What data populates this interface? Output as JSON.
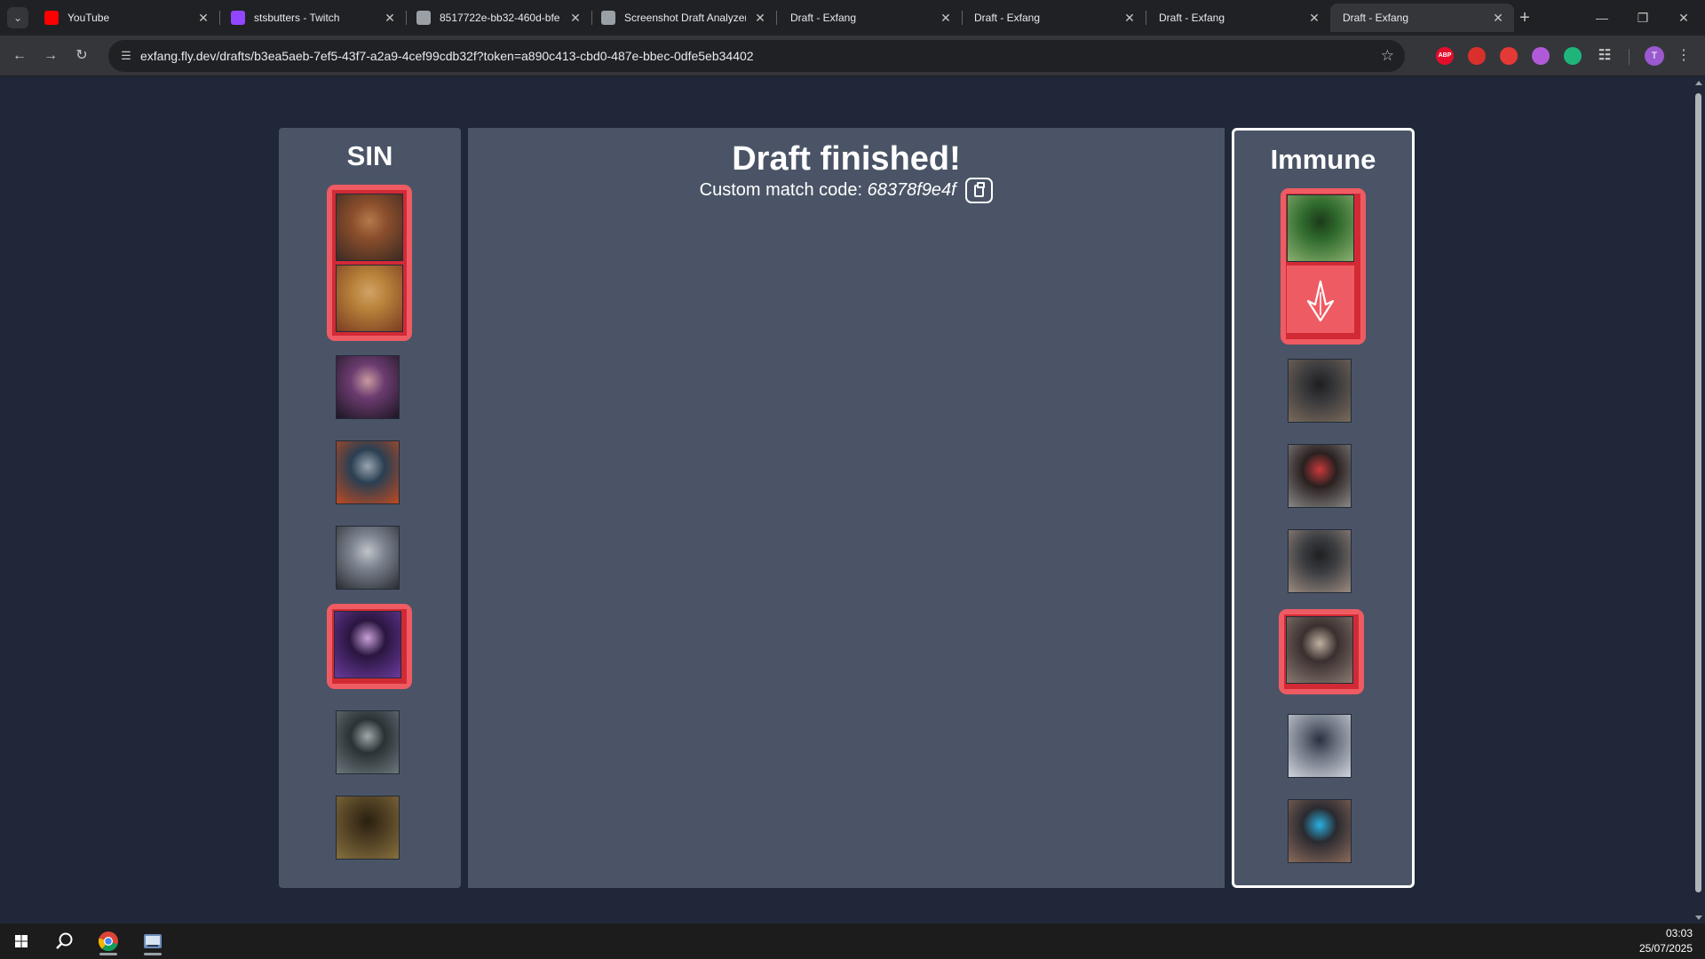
{
  "browser": {
    "tabs": [
      {
        "title": "YouTube",
        "favicon": "youtube-icon",
        "color": "#ff0000",
        "active": false
      },
      {
        "title": "stsbutters - Twitch",
        "favicon": "twitch-icon",
        "color": "#9146ff",
        "active": false
      },
      {
        "title": "8517722e-bb32-460d-bfe",
        "favicon": "globe-icon",
        "color": "#9aa0a6",
        "active": false
      },
      {
        "title": "Screenshot Draft Analyzer",
        "favicon": "openai-icon",
        "color": "#9aa0a6",
        "active": false
      },
      {
        "title": "Draft - Exfang",
        "favicon": "",
        "color": "",
        "active": false
      },
      {
        "title": "Draft - Exfang",
        "favicon": "",
        "color": "",
        "active": false
      },
      {
        "title": "Draft - Exfang",
        "favicon": "",
        "color": "",
        "active": false
      },
      {
        "title": "Draft - Exfang",
        "favicon": "",
        "color": "",
        "active": true
      }
    ],
    "url": "exfang.fly.dev/drafts/b3ea5aeb-7ef5-43f7-a2a9-4cef99cdb32f?token=a890c413-cbd0-487e-bbec-0dfe5eb34402",
    "extensions": [
      {
        "name": "adblock-plus-icon",
        "label": "ABP",
        "color": "#e40d2b"
      },
      {
        "name": "red-circle-extension-icon",
        "label": "",
        "color": "#d9302c"
      },
      {
        "name": "hand-extension-icon",
        "label": "",
        "color": "#e53935"
      },
      {
        "name": "purple-compass-extension-icon",
        "label": "",
        "color": "#b05ad9"
      },
      {
        "name": "green-smiley-extension-icon",
        "label": "",
        "color": "#1fb57a"
      }
    ],
    "profile_initial": "T"
  },
  "draft": {
    "title": "Draft finished!",
    "match_label": "Custom match code: ",
    "match_code": "68378f9e4f",
    "team_left": {
      "name": "SIN",
      "bans": [
        {
          "name": "warrior-with-rifle",
          "colors": [
            "#8a4e2c",
            "#3c2a22",
            "#b37a4a"
          ]
        },
        {
          "name": "monkey-king",
          "colors": [
            "#b7823a",
            "#7a3c22",
            "#d2a266"
          ]
        }
      ],
      "picks": [
        {
          "name": "dark-haired-woman",
          "colors": [
            "#6c3c70",
            "#1c1622",
            "#c89aa0"
          ],
          "highlighted": false
        },
        {
          "name": "orange-robot",
          "colors": [
            "#2a3f52",
            "#c04a20",
            "#9aa4b0"
          ],
          "highlighted": false
        },
        {
          "name": "bearded-engineer",
          "colors": [
            "#7c8490",
            "#2a2c30",
            "#c0c4c8"
          ],
          "highlighted": false
        },
        {
          "name": "hooded-assassin",
          "colors": [
            "#2a1640",
            "#6a3a9c",
            "#c8a0d8"
          ],
          "highlighted": true
        },
        {
          "name": "spiked-creature",
          "colors": [
            "#2a3236",
            "#6c767a",
            "#a0a8aa"
          ],
          "highlighted": false
        },
        {
          "name": "tree-beast",
          "colors": [
            "#4a3a20",
            "#86703e",
            "#2a2010"
          ],
          "highlighted": false
        }
      ]
    },
    "team_right": {
      "name": "Immune",
      "bans": [
        {
          "name": "green-haired-warrior",
          "colors": [
            "#2f6a2c",
            "#8ab070",
            "#1c3a1a"
          ],
          "empty": false
        },
        {
          "name": "empty-ban-logo",
          "colors": [
            "#ef5b63",
            "#ef5b63",
            "#ffffff"
          ],
          "empty": true
        }
      ],
      "picks": [
        {
          "name": "soldier-woman",
          "colors": [
            "#3a3a3c",
            "#7a6a5c",
            "#1e1e20"
          ],
          "highlighted": false
        },
        {
          "name": "masked-mechanic",
          "colors": [
            "#2a2020",
            "#8a8888",
            "#c83a3a"
          ],
          "highlighted": false
        },
        {
          "name": "female-soldier",
          "colors": [
            "#3a3c40",
            "#9a8a80",
            "#1e2022"
          ],
          "highlighted": false
        },
        {
          "name": "wolf-beast",
          "colors": [
            "#3a3030",
            "#8a7a70",
            "#c0b0a0"
          ],
          "highlighted": true
        },
        {
          "name": "white-haired-knight",
          "colors": [
            "#6a7280",
            "#d0d4dc",
            "#2a3040"
          ],
          "highlighted": false
        },
        {
          "name": "brunette-girl",
          "colors": [
            "#2a2a30",
            "#8a6a5a",
            "#2ab0e0"
          ],
          "highlighted": false
        }
      ]
    }
  },
  "taskbar": {
    "time": "03:03",
    "date": "25/07/2025"
  }
}
